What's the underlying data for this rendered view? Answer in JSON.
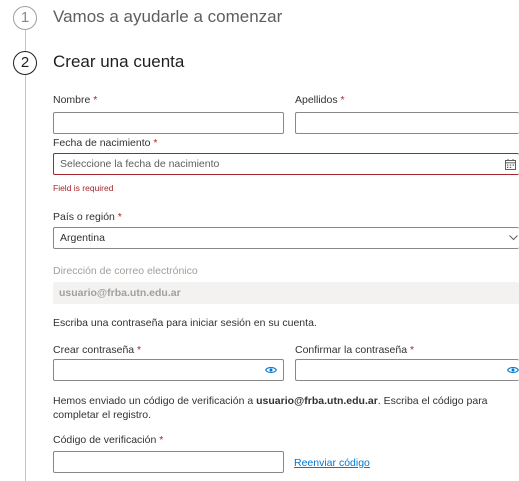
{
  "steps": [
    {
      "number": "1",
      "title": "Vamos a ayudarle a comenzar"
    },
    {
      "number": "2",
      "title": "Crear una cuenta"
    }
  ],
  "form": {
    "required_mark": "*",
    "first_name": {
      "label": "Nombre",
      "value": ""
    },
    "last_name": {
      "label": "Apellidos",
      "value": ""
    },
    "birthdate": {
      "label": "Fecha de nacimiento",
      "placeholder": "Seleccione la fecha de nacimiento",
      "error": "Field is required",
      "icon": "calendar-icon"
    },
    "country": {
      "label": "País o región",
      "value": "Argentina",
      "icon": "chevron-down-icon"
    },
    "email": {
      "label": "Dirección de correo electrónico",
      "value": "usuario@frba.utn.edu.ar"
    },
    "password_intro": "Escriba una contraseña para iniciar sesión en su cuenta.",
    "password": {
      "label": "Crear contraseña",
      "icon": "eye-icon"
    },
    "confirm_password": {
      "label": "Confirmar la contraseña",
      "icon": "eye-icon"
    },
    "verification_notice": {
      "prefix": "Hemos enviado un código de verificación a ",
      "email": "usuario@frba.utn.edu.ar",
      "suffix": ". Escriba el código para completar el registro."
    },
    "verification_code": {
      "label": "Código de verificación",
      "value": ""
    },
    "resend_link": "Reenviar código"
  },
  "colors": {
    "accent": "#0078d4",
    "error": "#a4262c",
    "border": "#8a8886"
  }
}
